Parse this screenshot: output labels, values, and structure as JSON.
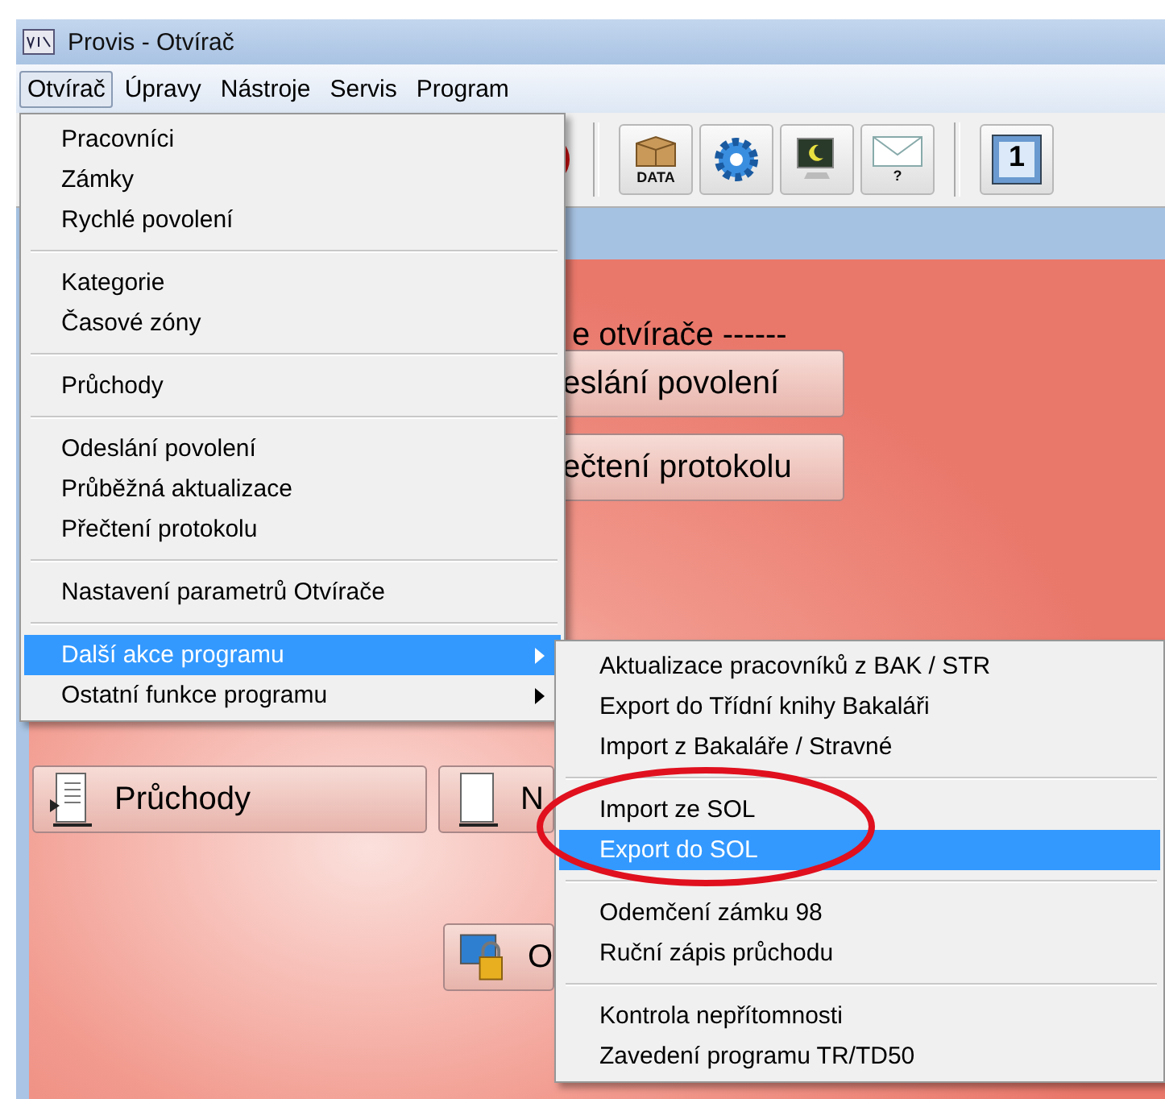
{
  "window": {
    "title": "Provis - Otvírač"
  },
  "menubar": [
    {
      "label": "Otvírač",
      "selected": true
    },
    {
      "label": "Úpravy",
      "selected": false
    },
    {
      "label": "Nástroje",
      "selected": false
    },
    {
      "label": "Servis",
      "selected": false
    },
    {
      "label": "Program",
      "selected": false
    }
  ],
  "toolbar": [
    {
      "kind": "alarm"
    },
    {
      "kind": "separator"
    },
    {
      "kind": "box",
      "label": "DATA"
    },
    {
      "kind": "gear"
    },
    {
      "kind": "monitor"
    },
    {
      "kind": "mail",
      "label": "?"
    },
    {
      "kind": "separator"
    },
    {
      "kind": "screen",
      "label": "1"
    }
  ],
  "content": {
    "heading": "e otvírače ------",
    "top_buttons": [
      {
        "label": "eslání povolení"
      },
      {
        "label": "ečtení protokolu"
      }
    ],
    "bottom_buttons": [
      {
        "kind": "document",
        "label": "Průchody"
      },
      {
        "kind": "page",
        "label": "N"
      },
      {
        "kind": "lock",
        "label": "O"
      }
    ]
  },
  "menu": {
    "items": [
      {
        "kind": "item",
        "label": "Pracovníci",
        "selected": false,
        "has_submenu": false
      },
      {
        "kind": "item",
        "label": "Zámky",
        "selected": false,
        "has_submenu": false
      },
      {
        "kind": "item",
        "label": "Rychlé povolení",
        "selected": false,
        "has_submenu": false
      },
      {
        "kind": "separator"
      },
      {
        "kind": "item",
        "label": "Kategorie",
        "selected": false,
        "has_submenu": false
      },
      {
        "kind": "item",
        "label": "Časové zóny",
        "selected": false,
        "has_submenu": false
      },
      {
        "kind": "separator"
      },
      {
        "kind": "item",
        "label": "Průchody",
        "selected": false,
        "has_submenu": false
      },
      {
        "kind": "separator"
      },
      {
        "kind": "item",
        "label": "Odeslání povolení",
        "selected": false,
        "has_submenu": false
      },
      {
        "kind": "item",
        "label": "Průběžná aktualizace",
        "selected": false,
        "has_submenu": false
      },
      {
        "kind": "item",
        "label": "Přečtení protokolu",
        "selected": false,
        "has_submenu": false
      },
      {
        "kind": "separator"
      },
      {
        "kind": "item",
        "label": "Nastavení parametrů Otvírače",
        "selected": false,
        "has_submenu": false
      },
      {
        "kind": "separator"
      },
      {
        "kind": "item",
        "label": "Další akce programu",
        "selected": true,
        "has_submenu": true
      },
      {
        "kind": "item",
        "label": "Ostatní funkce programu",
        "selected": false,
        "has_submenu": true
      }
    ]
  },
  "submenu": {
    "items": [
      {
        "kind": "item",
        "label": "Aktualizace pracovníků z BAK / STR",
        "selected": false
      },
      {
        "kind": "item",
        "label": "Export do Třídní knihy Bakaláři",
        "selected": false
      },
      {
        "kind": "item",
        "label": "Import z Bakaláře / Stravné",
        "selected": false
      },
      {
        "kind": "separator"
      },
      {
        "kind": "item",
        "label": "Import ze SOL",
        "selected": false
      },
      {
        "kind": "item",
        "label": "Export do SOL",
        "selected": true
      },
      {
        "kind": "separator"
      },
      {
        "kind": "item",
        "label": "Odemčení zámku 98",
        "selected": false
      },
      {
        "kind": "item",
        "label": "Ruční zápis průchodu",
        "selected": false
      },
      {
        "kind": "separator"
      },
      {
        "kind": "item",
        "label": "Kontrola nepřítomnosti",
        "selected": false
      },
      {
        "kind": "item",
        "label": "Zavedení programu TR/TD50",
        "selected": false
      }
    ]
  }
}
